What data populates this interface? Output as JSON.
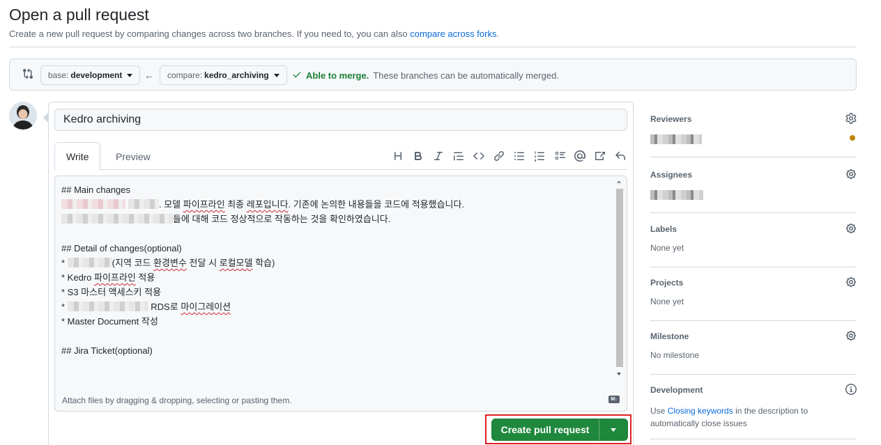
{
  "header": {
    "title": "Open a pull request",
    "subtitle_prefix": "Create a new pull request by comparing changes across two branches. If you need to, you can also ",
    "subtitle_link": "compare across forks",
    "subtitle_suffix": "."
  },
  "branches": {
    "base_label": "base:",
    "base_value": "development",
    "compare_label": "compare:",
    "compare_value": "kedro_archiving",
    "merge_ok": "Able to merge.",
    "merge_text": "These branches can be automatically merged."
  },
  "editor": {
    "title_value": "Kedro archiving",
    "tabs": [
      "Write",
      "Preview"
    ],
    "toolbar_icons": [
      "heading-icon",
      "bold-icon",
      "italic-icon",
      "quote-icon",
      "code-icon",
      "link-icon",
      "unordered-list-icon",
      "ordered-list-icon",
      "task-list-icon",
      "mention-icon",
      "reference-icon",
      "undo-icon"
    ],
    "body": {
      "l1": "## Main changes",
      "l2": ". 모델 ",
      "l2b": "파이프라인",
      "l2c": " 최종 ",
      "l2d": "레포입니다",
      "l2e": ". 기존에 논의한 내용들을 코드에 적용했습니다.",
      "l3": "들에 대해 코드 정상적으로 작동하는 것을 확인하였습니다.",
      "l5": "## Detail of changes(optional)",
      "l6a": "* ",
      "l6b": "(지역 코드 ",
      "l6c": "환경변수",
      "l6d": " 전달 시 ",
      "l6e": "로컬모델",
      "l6f": " 학습)",
      "l7a": "* Kedro ",
      "l7b": "파이프라인",
      "l7c": " 적용",
      "l8": "* S3 마스터 액세스키 적용",
      "l9a": "* ",
      "l9b": " RDS로 ",
      "l9c": "마이그레이션",
      "l10": "* Master Document 작성",
      "l12": "## Jira Ticket(optional)"
    },
    "attach_text": "Attach files by dragging & dropping, selecting or pasting them.",
    "markdown_badge": "M↓"
  },
  "actions": {
    "create_label": "Create pull request"
  },
  "sidebar": {
    "reviewers": "Reviewers",
    "assignees": "Assignees",
    "labels": "Labels",
    "labels_value": "None yet",
    "projects": "Projects",
    "projects_value": "None yet",
    "milestone": "Milestone",
    "milestone_value": "No milestone",
    "development": "Development",
    "development_prefix": "Use ",
    "development_link": "Closing keywords",
    "development_suffix": " in the description to",
    "development_line2": "automatically close issues"
  },
  "colors": {
    "accent_green": "#1f883d",
    "link_blue": "#0969da",
    "merge_ok_green": "#1a7f37",
    "highlight_red": "#e02020",
    "reviewer_status_dot": "#bf8700"
  }
}
